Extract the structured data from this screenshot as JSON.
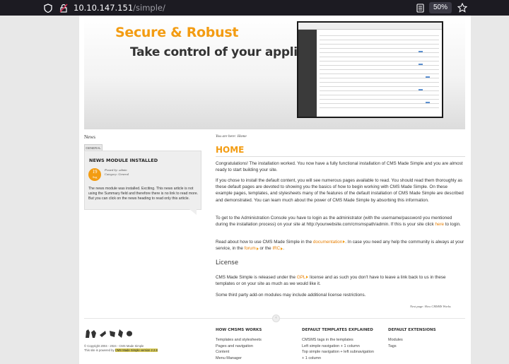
{
  "browser": {
    "url_host": "10.10.147.151",
    "url_path": "/simple/",
    "zoom": "50%",
    "icons": [
      "shield-icon",
      "lock-warning-icon",
      "reader-view-icon",
      "bookmark-star-icon"
    ]
  },
  "banner": {
    "headline": "Secure & Robust",
    "subheadline": "Take control of your application"
  },
  "sidebar": {
    "title": "News",
    "category_tab": "GENERAL",
    "article": {
      "heading": "NEWS MODULE INSTALLED",
      "date_day": "19",
      "date_month": "Aug",
      "posted_by": "Posted by: admin",
      "category": "Category: General",
      "body": "The news module was installed. Exciting. This news article is not using the Summary field and therefore there is no link to read more. But you can click on the news heading to read only this article."
    }
  },
  "content": {
    "breadcrumb": "You are here: Home",
    "heading": "HOME",
    "p1": "Congratulations! The installation worked. You now have a fully functional installation of CMS Made Simple and you are almost ready to start building your site.",
    "p2": "If you chose to install the default content, you will see numerous pages available to read. You should read them thoroughly as these default pages are devoted to showing you the basics of how to begin working with CMS Made Simple. On these example pages, templates, and stylesheets many of the features of the default installation of CMS Made Simple are described and demonstrated. You can learn much about the power of CMS Made Simple by absorbing this information.",
    "p3_a": "To get to the Administration Console you have to login as the administrator (with the username/password you mentioned during the installation process) on your site at http://yourwebsite.com/cmsmspath/admin. If this is your site click ",
    "p3_link": "here",
    "p3_b": " to login.",
    "p4_a": "Read about how to use CMS Made Simple in the ",
    "p4_link1": "documentation",
    "p4_b": ". In case you need any help the community is always at your service, in the ",
    "p4_link2": "forum",
    "p4_c": " or the ",
    "p4_link3": "IRC",
    "p4_d": ".",
    "license_heading": "License",
    "p5_a": "CMS Made Simple is released under the ",
    "p5_link": "GPL",
    "p5_b": " license and as such you don't have to leave a link back to us in these templates or on your site as much as we would like it.",
    "p6": "Some third party add-on modules may include additional license restrictions.",
    "next_page": "Next page: How CMSMS Works"
  },
  "footer": {
    "copyright": "© Copyright 2004 - 2024 - CMS Made Simple",
    "powered_a": "This site is powered by ",
    "powered_version": "CMS Made Simple version 2.2.8",
    "col1": {
      "heading": "HOW CMSMS WORKS",
      "items": [
        "Templates and stylesheets",
        "Pages and navigation",
        "Content",
        "Menu Manager"
      ]
    },
    "col2": {
      "heading": "DEFAULT TEMPLATES EXPLAINED",
      "items": [
        "CMSMS tags in the templates",
        "Left simple navigation + 1 column",
        "Top simple navigation + left subnavigation",
        "+ 1 column"
      ]
    },
    "col3": {
      "heading": "DEFAULT EXTENSIONS",
      "items": [
        "Modules",
        "Tags"
      ]
    }
  },
  "colors": {
    "accent": "#f39c12",
    "toolbar": "#1c1b22"
  }
}
